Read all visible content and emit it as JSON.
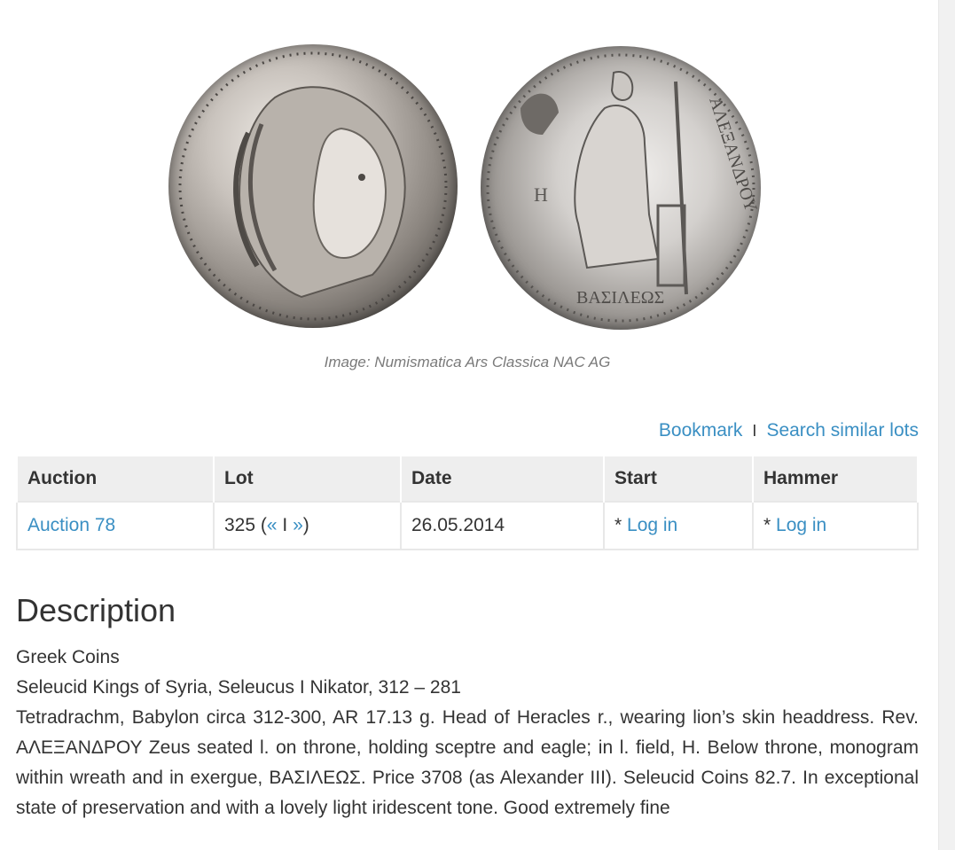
{
  "image": {
    "caption": "Image: Numismatica Ars Classica NAC AG",
    "obverse_alt": "Head of Heracles",
    "reverse_legend": "ΑΛΕΞΑΝΔΡΟΥ",
    "reverse_exergue": "ΒΑΣΙΛΕΩΣ",
    "reverse_field_letter": "Η"
  },
  "actions": {
    "bookmark": "Bookmark",
    "separator": "I",
    "search_similar": "Search similar lots"
  },
  "table": {
    "headers": [
      "Auction",
      "Lot",
      "Date",
      "Start",
      "Hammer"
    ],
    "row": {
      "auction": "Auction 78",
      "lot_number": "325",
      "lot_prev": "«",
      "lot_sep": "I",
      "lot_next": "»",
      "date": "26.05.2014",
      "start_prefix": "* ",
      "start_link": "Log in",
      "hammer_prefix": "* ",
      "hammer_link": "Log in"
    }
  },
  "description": {
    "title": "Description",
    "category": "Greek Coins",
    "subcategory": "Seleucid Kings of Syria, Seleucus I Nikator, 312 – 281",
    "body": "Tetradrachm, Babylon circa 312-300, AR 17.13 g. Head of Heracles r., wearing lion’s skin headdress. Rev. ΑΛΕΞΑΝΔΡΟΥ Zeus seated l. on throne, holding sceptre and eagle; in l. field, H. Below throne, monogram within wreath and in exergue, ΒΑΣΙΛΕΩΣ. Price 3708 (as Alexander III). Seleucid Coins 82.7. In exceptional state of preservation and with a lovely light iridescent tone. Good extremely fine"
  }
}
